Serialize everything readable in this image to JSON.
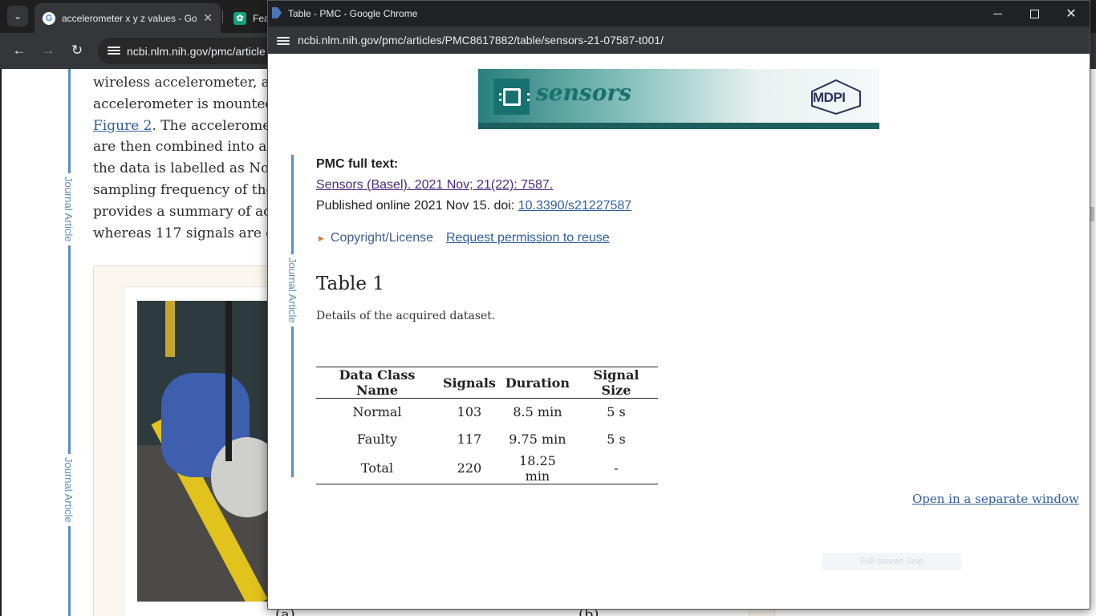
{
  "background_browser": {
    "tabs": [
      {
        "title": "accelerometer x y z values - Go",
        "favicon": "google-icon"
      },
      {
        "title": "Feat",
        "favicon": "chatgpt-icon"
      }
    ],
    "url": "ncbi.nlm.nih.gov/pmc/article",
    "article_lines": [
      "wireless accelerometer, a",
      "accelerometer is mounted",
      "Figure 2",
      ". The acceleromet",
      "are then combined into a",
      "the data is labelled as Nor",
      "sampling frequency of the",
      "provides a summary of ac",
      "whereas 117 signals are c"
    ],
    "side_label": "Journal Article",
    "figure_labels": [
      "(a)",
      "(b)"
    ]
  },
  "popup": {
    "window_title": "Table - PMC - Google Chrome",
    "url": "ncbi.nlm.nih.gov/pmc/articles/PMC8617882/table/sensors-21-07587-t001/",
    "banner": {
      "journal": "sensors",
      "publisher": "MDPI"
    },
    "side_label": "Journal Article",
    "pmc_full_text": "PMC full text:",
    "citation": "Sensors (Basel). 2021 Nov; 21(22): 7587.",
    "published_prefix": "Published online 2021 Nov 15. doi: ",
    "doi": "10.3390/s21227587",
    "copyright_label": "Copyright/License",
    "request_permission": "Request permission to reuse",
    "table_title": "Table 1",
    "table_caption": "Details of the acquired dataset.",
    "table": {
      "headers": [
        "Data Class Name",
        "Signals",
        "Duration",
        "Signal Size"
      ],
      "rows": [
        [
          "Normal",
          "103",
          "8.5 min",
          "5 s"
        ],
        [
          "Faulty",
          "117",
          "9.75 min",
          "5 s"
        ],
        [
          "Total",
          "220",
          "18.25 min",
          "-"
        ]
      ]
    },
    "open_separate": "Open in a separate window",
    "snip_overlay": "Full-screen Snip"
  },
  "colors": {
    "link": "#2f5d9b",
    "visited_link": "#4b2a7f",
    "rule": "#5b8ec2",
    "sensors_teal": "#17716f"
  }
}
